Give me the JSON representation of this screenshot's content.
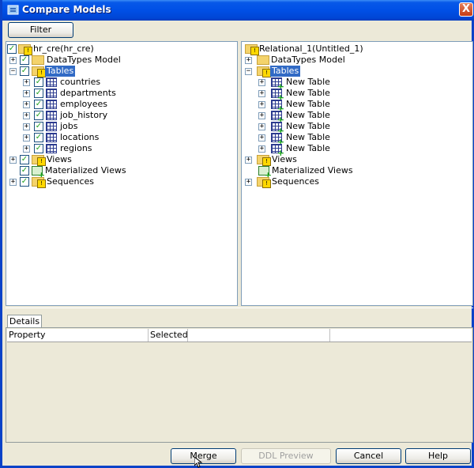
{
  "window": {
    "title": "Compare Models",
    "close_glyph": "X"
  },
  "toolbar": {
    "filter_label": "Filter"
  },
  "left_tree": {
    "root": "hr_cre(hr_cre)",
    "datatypes": "DataTypes Model",
    "tables": "Tables",
    "table_items": [
      "countries",
      "departments",
      "employees",
      "job_history",
      "jobs",
      "locations",
      "regions"
    ],
    "views": "Views",
    "mviews": "Materialized Views",
    "sequences": "Sequences"
  },
  "right_tree": {
    "root": "Relational_1(Untitled_1)",
    "datatypes": "DataTypes Model",
    "tables": "Tables",
    "table_items": [
      "New Table",
      "New Table",
      "New Table",
      "New Table",
      "New Table",
      "New Table",
      "New Table"
    ],
    "views": "Views",
    "mviews": "Materialized Views",
    "sequences": "Sequences"
  },
  "details": {
    "tab_label": "Details",
    "columns": [
      "Property",
      "Selected",
      "",
      ""
    ]
  },
  "buttons": {
    "merge": "Merge",
    "ddl_preview": "DDL Preview",
    "cancel": "Cancel",
    "help": "Help"
  },
  "colors": {
    "title_blue": "#0050e6",
    "selection": "#316ac5",
    "dialog_bg": "#ece9d8"
  }
}
